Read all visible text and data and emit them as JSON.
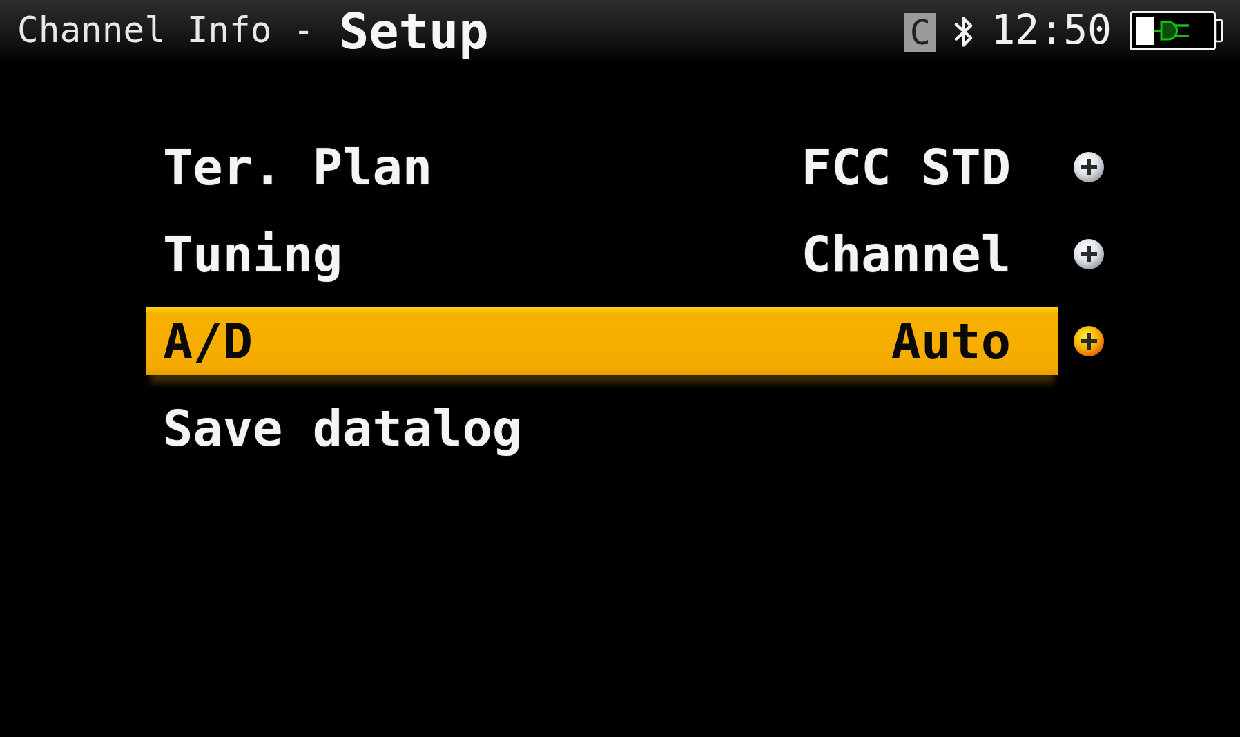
{
  "header": {
    "section": "Channel Info -",
    "title": "Setup",
    "status": {
      "mode": "C",
      "time": "12:50"
    }
  },
  "menu": {
    "items": [
      {
        "kind": "option",
        "label": "Ter. Plan",
        "value": "FCC STD",
        "selected": false
      },
      {
        "kind": "option",
        "label": "Tuning",
        "value": "Channel",
        "selected": false
      },
      {
        "kind": "option",
        "label": "A/D",
        "value": "Auto",
        "selected": true
      },
      {
        "kind": "action",
        "label": "Save datalog",
        "selected": false
      }
    ]
  }
}
